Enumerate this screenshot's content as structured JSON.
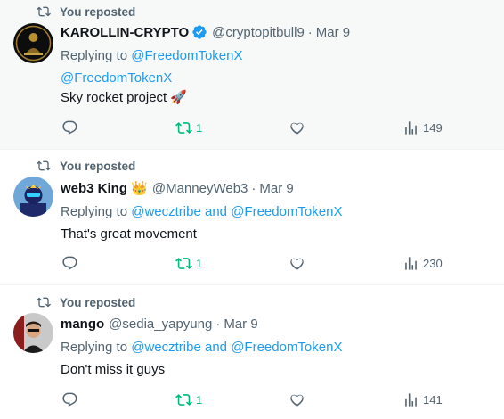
{
  "tweets": [
    {
      "repost_label": "You reposted",
      "name": "KAROLLIN-CRYPTO",
      "handle": "@cryptopitbull9",
      "date": "Mar 9",
      "replying_prefix": "Replying to",
      "mentions": [
        "@FreedomTokenX",
        "@FreedomTokenX"
      ],
      "text": "Sky rocket project 🚀",
      "reposts": "1",
      "views": "149"
    },
    {
      "repost_label": "You reposted",
      "name": "web3 King",
      "name_emoji": "👑",
      "handle": "@ManneyWeb3",
      "date": "Mar 9",
      "replying_prefix": "Replying to",
      "mentions": [
        "@wecztribe",
        "@FreedomTokenX"
      ],
      "conjunction": "and",
      "text": "That's great movement",
      "reposts": "1",
      "views": "230"
    },
    {
      "repost_label": "You reposted",
      "name": "mango",
      "handle": "@sedia_yapyung",
      "date": "Mar 9",
      "replying_prefix": "Replying to",
      "mentions": [
        "@wecztribe",
        "@FreedomTokenX"
      ],
      "conjunction": "and",
      "text": "Don't miss it guys",
      "reposts": "1",
      "views": "141"
    }
  ],
  "colors": {
    "accent": "#1d9bf0",
    "repost_green": "#00ba7c",
    "muted": "#536471"
  },
  "icons": [
    "repost-icon",
    "verified-badge-icon",
    "reply-icon",
    "like-icon",
    "views-icon"
  ]
}
